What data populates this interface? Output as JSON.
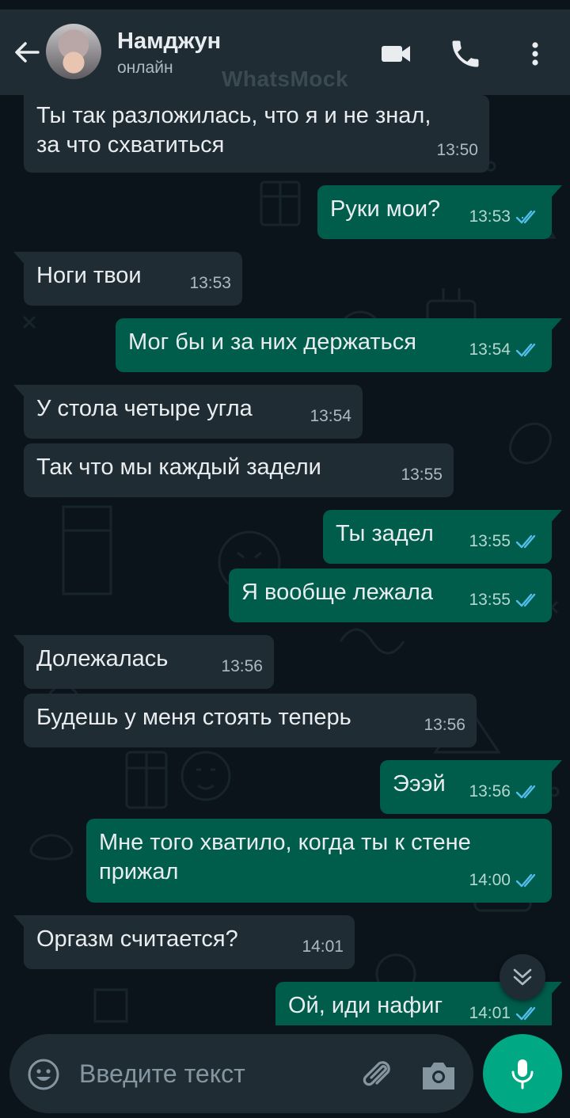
{
  "header": {
    "contact_name": "Намджун",
    "status": "онлайн",
    "icons": [
      "back-arrow-icon",
      "video-call-icon",
      "phone-icon",
      "more-vert-icon"
    ]
  },
  "watermark": "WhatsMock",
  "messages": [
    {
      "dir": "in",
      "text": "Ты так разложилась, что я и не знал,\nза что схватиться",
      "time": "13:50"
    },
    {
      "dir": "out",
      "text": "Руки мои?",
      "time": "13:53",
      "read": true
    },
    {
      "dir": "in",
      "text": "Ноги твои",
      "time": "13:53"
    },
    {
      "dir": "out",
      "text": "Мог бы и за них держаться",
      "time": "13:54",
      "read": true
    },
    {
      "dir": "in",
      "text": "У стола четыре угла",
      "time": "13:54"
    },
    {
      "dir": "in",
      "text": "Так что мы каждый задели",
      "time": "13:55"
    },
    {
      "dir": "out",
      "text": "Ты задел",
      "time": "13:55",
      "read": true
    },
    {
      "dir": "out",
      "text": "Я вообще лежала",
      "time": "13:55",
      "read": true
    },
    {
      "dir": "in",
      "text": "Долежалась",
      "time": "13:56"
    },
    {
      "dir": "in",
      "text": "Будешь у меня стоять теперь",
      "time": "13:56"
    },
    {
      "dir": "out",
      "text": "Эээй",
      "time": "13:56",
      "read": true
    },
    {
      "dir": "out",
      "text": "Мне того хватило, когда ты к стене\nприжал",
      "time": "14:00",
      "read": true
    },
    {
      "dir": "in",
      "text": "Оргазм считается?",
      "time": "14:01"
    },
    {
      "dir": "out",
      "text": "Ой, иди нафиг",
      "time": "14:01",
      "read": true
    }
  ],
  "composer": {
    "placeholder": "Введите текст",
    "icons": [
      "emoji-icon",
      "attach-icon",
      "camera-icon",
      "mic-icon"
    ]
  },
  "colors": {
    "chat_bg": "#0b141a",
    "header_bg": "#1f2c34",
    "incoming_bubble": "#1f2c34",
    "outgoing_bubble": "#005c4b",
    "read_ticks": "#53bdeb",
    "accent": "#00a884"
  }
}
